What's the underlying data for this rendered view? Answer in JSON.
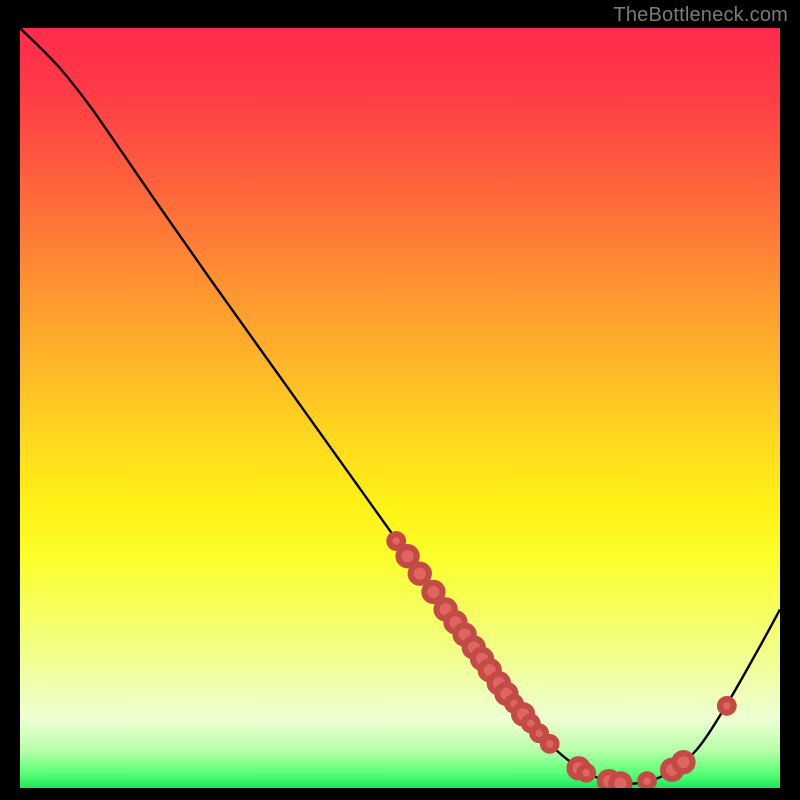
{
  "attribution": "TheBottleneck.com",
  "chart_data": {
    "type": "line",
    "title": "",
    "xlabel": "",
    "ylabel": "",
    "xlim": [
      0,
      100
    ],
    "ylim": [
      0,
      100
    ],
    "curve": [
      {
        "x": 0.0,
        "y": 100.0
      },
      {
        "x": 5.0,
        "y": 95.0
      },
      {
        "x": 9.0,
        "y": 90.0
      },
      {
        "x": 12.5,
        "y": 85.0
      },
      {
        "x": 18.0,
        "y": 77.0
      },
      {
        "x": 25.0,
        "y": 67.0
      },
      {
        "x": 35.0,
        "y": 53.0
      },
      {
        "x": 45.0,
        "y": 39.0
      },
      {
        "x": 55.0,
        "y": 25.0
      },
      {
        "x": 62.0,
        "y": 15.0
      },
      {
        "x": 68.0,
        "y": 7.5
      },
      {
        "x": 73.0,
        "y": 3.0
      },
      {
        "x": 77.0,
        "y": 1.0
      },
      {
        "x": 81.0,
        "y": 0.6
      },
      {
        "x": 85.0,
        "y": 1.8
      },
      {
        "x": 89.0,
        "y": 5.0
      },
      {
        "x": 93.0,
        "y": 11.0
      },
      {
        "x": 97.0,
        "y": 18.0
      },
      {
        "x": 100.0,
        "y": 23.5
      }
    ],
    "marker_radius_small": 0.9,
    "marker_radius_large": 1.2,
    "markers": [
      {
        "x": 49.5,
        "y": 32.5,
        "r": "small"
      },
      {
        "x": 51.0,
        "y": 30.5,
        "r": "large"
      },
      {
        "x": 52.6,
        "y": 28.2,
        "r": "large"
      },
      {
        "x": 54.4,
        "y": 25.8,
        "r": "large"
      },
      {
        "x": 56.0,
        "y": 23.5,
        "r": "large"
      },
      {
        "x": 57.3,
        "y": 21.8,
        "r": "large"
      },
      {
        "x": 58.5,
        "y": 20.2,
        "r": "large"
      },
      {
        "x": 59.7,
        "y": 18.5,
        "r": "large"
      },
      {
        "x": 60.8,
        "y": 17.0,
        "r": "large"
      },
      {
        "x": 61.8,
        "y": 15.5,
        "r": "large"
      },
      {
        "x": 63.0,
        "y": 13.8,
        "r": "large"
      },
      {
        "x": 64.0,
        "y": 12.4,
        "r": "large"
      },
      {
        "x": 65.0,
        "y": 11.1,
        "r": "small"
      },
      {
        "x": 66.2,
        "y": 9.7,
        "r": "large"
      },
      {
        "x": 67.2,
        "y": 8.5,
        "r": "small"
      },
      {
        "x": 68.3,
        "y": 7.2,
        "r": "small"
      },
      {
        "x": 69.7,
        "y": 5.8,
        "r": "small"
      },
      {
        "x": 73.5,
        "y": 2.6,
        "r": "large"
      },
      {
        "x": 74.5,
        "y": 2.0,
        "r": "small"
      },
      {
        "x": 77.5,
        "y": 0.9,
        "r": "large"
      },
      {
        "x": 79.0,
        "y": 0.6,
        "r": "large"
      },
      {
        "x": 82.5,
        "y": 0.9,
        "r": "small"
      },
      {
        "x": 85.8,
        "y": 2.4,
        "r": "large"
      },
      {
        "x": 87.3,
        "y": 3.4,
        "r": "large"
      },
      {
        "x": 93.0,
        "y": 10.8,
        "r": "small"
      }
    ]
  }
}
